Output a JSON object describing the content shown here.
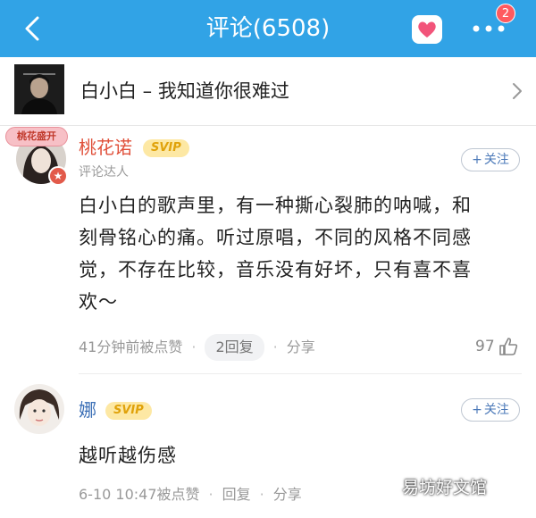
{
  "header": {
    "title": "评论(6508)",
    "notification_count": "2",
    "accent": "#31a3e6"
  },
  "song": {
    "title": "白小白 – 我知道你很难过"
  },
  "comments": [
    {
      "username": "桃花诺",
      "vip": "SVIP",
      "badge_text": "桃花盛开",
      "subtitle": "评论达人",
      "follow": "关注",
      "content_lines": [
        "白小白的歌声里，有一种撕心裂肺的呐喊，和",
        "刻骨铭心的痛。听过原唱，不同的风格不同感",
        "觉，不存在比较，音乐没有好坏，只有喜不喜",
        "欢～"
      ],
      "time": "41分钟前被点赞",
      "reply": "2回复",
      "share": "分享",
      "likes": "97"
    },
    {
      "username": "娜",
      "vip": "SVIP",
      "follow": "关注",
      "content_lines": [
        "越听越伤感"
      ],
      "time": "6-10 10:47被点赞",
      "reply": "回复",
      "share": "分享"
    }
  ],
  "watermark": "易坊好文馆",
  "colors": {
    "username_red": "#e0503a",
    "username_blue": "#3b6fb6",
    "svip_bg": "#fde8a4",
    "svip_text": "#e0a20a"
  }
}
